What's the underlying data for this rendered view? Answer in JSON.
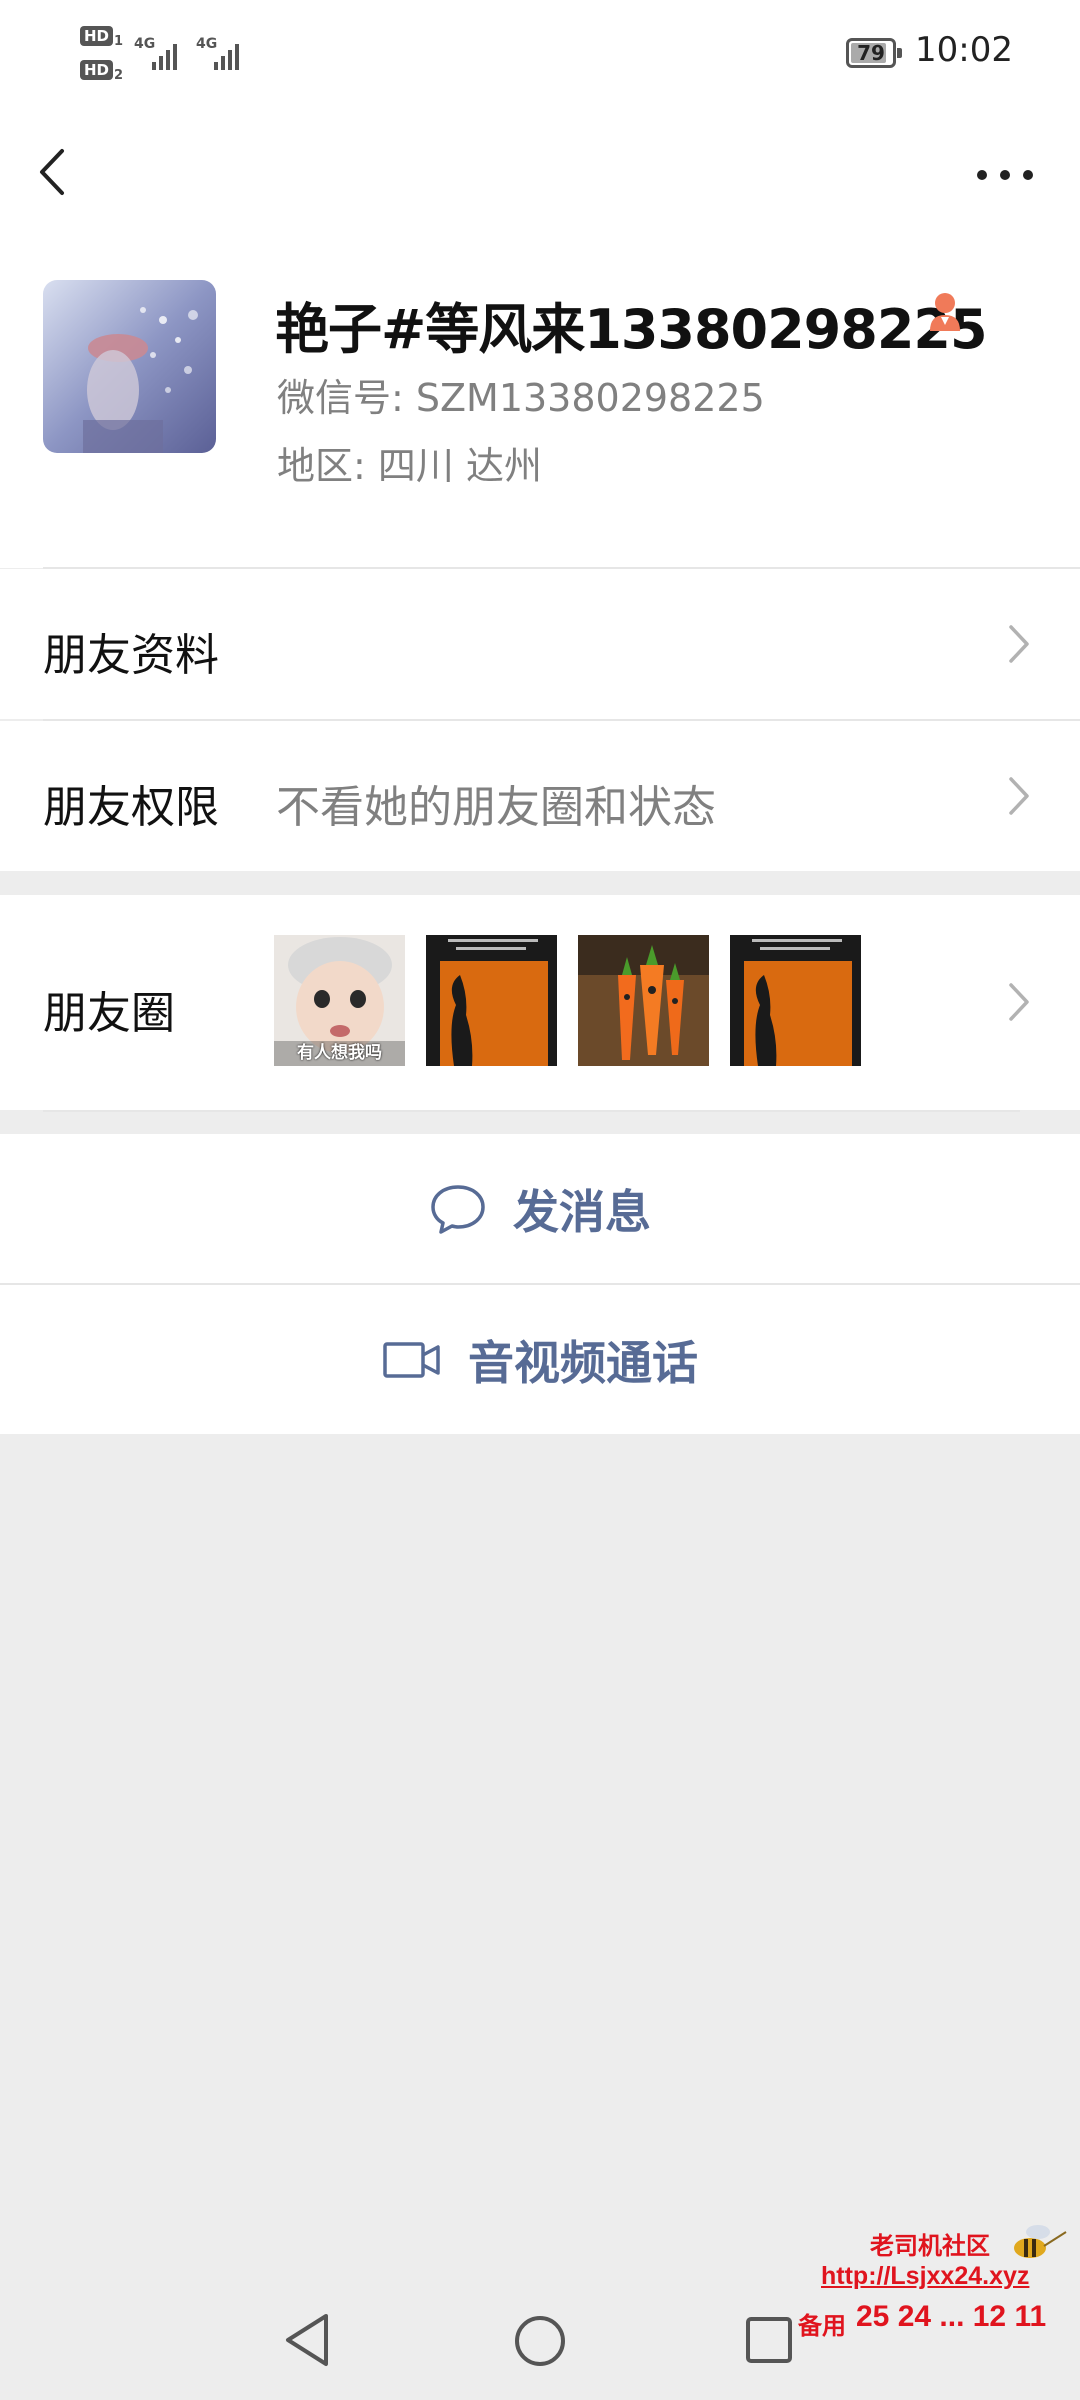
{
  "status_bar": {
    "sim1_badge": "HD",
    "sim1_num": "1",
    "sim2_badge": "HD",
    "sim2_num": "2",
    "network1": "4G",
    "network2": "4G",
    "battery": "79",
    "battery_level": 0.79,
    "time": "10:02"
  },
  "nav": {
    "back_icon": "chevron-left-icon",
    "more_icon": "more-dots-icon"
  },
  "profile": {
    "name": "艳子#等风来13380298225",
    "gender_icon": "female-icon",
    "wechat_id": "微信号: SZM13380298225",
    "region": "地区: 四川  达州"
  },
  "rows": {
    "friend_info": {
      "label": "朋友资料"
    },
    "permissions": {
      "label": "朋友权限",
      "value": "不看她的朋友圈和状态"
    },
    "moments": {
      "label": "朋友圈",
      "thumb1_caption": "有人想我吗"
    }
  },
  "actions": {
    "message": {
      "label": "发消息",
      "icon": "chat-bubble-icon"
    },
    "call": {
      "label": "音视频通话",
      "icon": "video-camera-icon"
    }
  },
  "watermark": {
    "line1": "老司机社区",
    "line2": "http://Lsjxx24.xyz",
    "line3_prefix": "备用",
    "line3_nums": "25 24  ... 12 11"
  },
  "colors": {
    "link_blue": "#576b95",
    "female_orange": "#f07a59",
    "secondary_gray": "#808080",
    "page_bg": "#ededed"
  }
}
